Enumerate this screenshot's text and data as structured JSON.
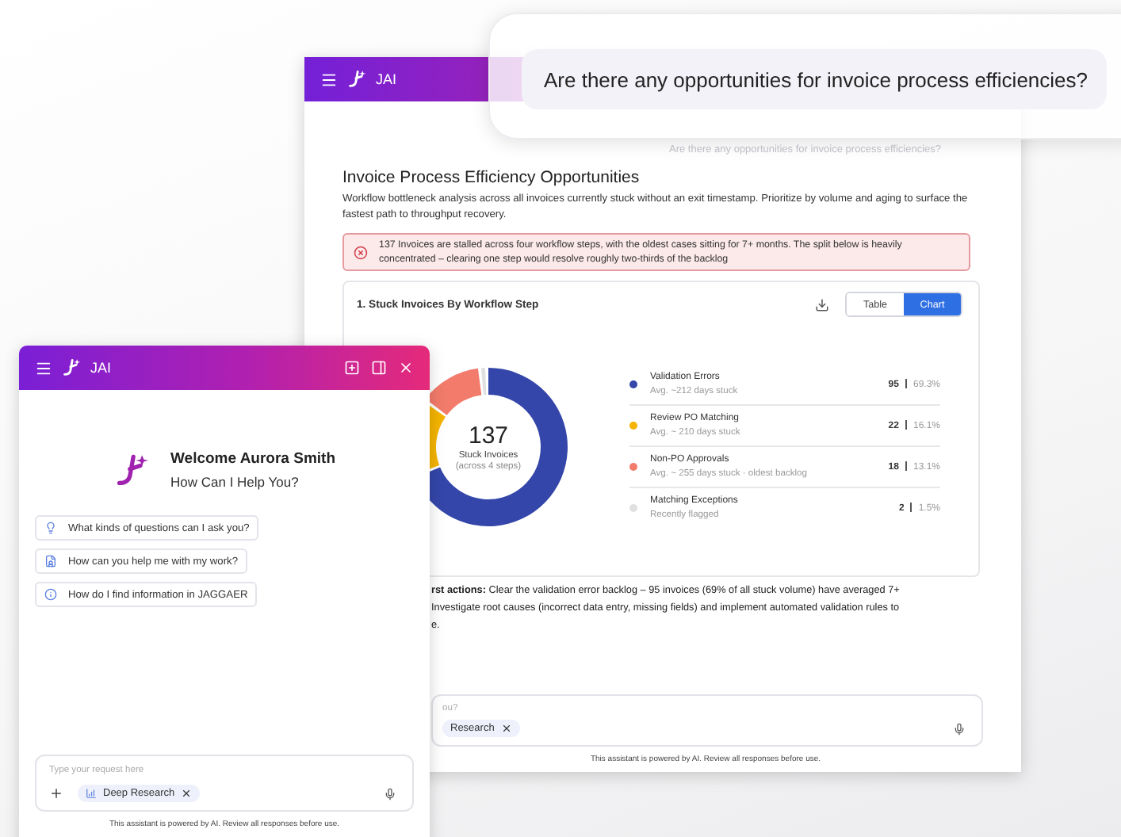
{
  "question_bubble": {
    "text": "Are there any opportunities for invoice process efficiencies?"
  },
  "report_window": {
    "title": "JAI",
    "user_message": "Are there any opportunities for invoice process efficiencies?",
    "heading": "Invoice Process Efficiency Opportunities",
    "description": "Workflow bottleneck analysis across all invoices currently stuck without an exit timestamp. Prioritize by volume and aging to surface the fastest path to throughput recovery.",
    "alert": "137 Invoices are stalled across four workflow steps, with the oldest cases sitting for 7+ months. The split below is heavily concentrated – clearing one step would resolve roughly two-thirds of the backlog",
    "card": {
      "title": "1. Stuck Invoices By Workflow Step",
      "view_toggle": [
        {
          "label": "Table",
          "selected": false
        },
        {
          "label": "Chart",
          "selected": true
        }
      ],
      "donut_center": {
        "value": "137",
        "label": "Stuck Invoices",
        "sublabel": "(across 4 steps)"
      },
      "legend": [
        {
          "name": "Validation Errors",
          "detail": "Avg. ~212 days stuck",
          "count": "95",
          "percent": "69.3%",
          "color": "#3446a9"
        },
        {
          "name": "Review PO Matching",
          "detail": "Avg. ~ 210 days stuck",
          "count": "22",
          "percent": "16.1%",
          "color": "#f4b400"
        },
        {
          "name": "Non-PO Approvals",
          "detail": "Avg. ~ 255 days stuck · oldest backlog",
          "count": "18",
          "percent": "13.1%",
          "color": "#f27b6b"
        },
        {
          "name": "Matching Exceptions",
          "detail": "Recently flagged",
          "count": "2",
          "percent": "1.5%",
          "color": "#e0e0e0"
        }
      ]
    },
    "summary_lines": [
      "**rst actions:** Clear the validation error backlog – 95 invoices (69% of all stuck volume) have averaged 7+",
      "Investigate root causes (incorrect data entry, missing fields) and implement automated validation rules to",
      "e."
    ],
    "input": {
      "placeholder": "ou?",
      "chip": "Research"
    },
    "footer": "This assistant is powered by AI. Review all responses before use."
  },
  "chat_window": {
    "title": "JAI",
    "welcome": "Welcome Aurora Smith",
    "subtitle": "How Can I Help You?",
    "suggestions": [
      {
        "kind": "idea",
        "text": "What kinds of questions can I ask you?"
      },
      {
        "kind": "work",
        "text": "How can you help me with my work?"
      },
      {
        "kind": "info",
        "text": "How do I find information in JAGGAER"
      }
    ],
    "input": {
      "placeholder": "Type your request here",
      "chip": "Deep Research"
    },
    "footer": "This assistant is powered by AI. Review all responses before use."
  }
}
